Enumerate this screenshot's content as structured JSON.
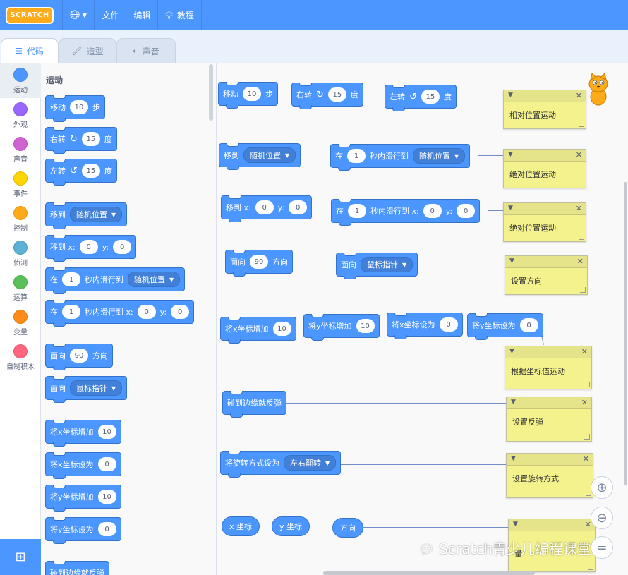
{
  "menubar": {
    "logo": "SCRATCH",
    "file": "文件",
    "edit": "编辑",
    "tutorials": "教程"
  },
  "tabs": {
    "code": "代码",
    "costumes": "造型",
    "sounds": "声音"
  },
  "categories": [
    {
      "label": "运动",
      "color": "#4c97ff"
    },
    {
      "label": "外观",
      "color": "#9966ff"
    },
    {
      "label": "声音",
      "color": "#cf63cf"
    },
    {
      "label": "事件",
      "color": "#ffd500"
    },
    {
      "label": "控制",
      "color": "#ffab19"
    },
    {
      "label": "侦测",
      "color": "#5cb1d6"
    },
    {
      "label": "运算",
      "color": "#59c059"
    },
    {
      "label": "变量",
      "color": "#ff8c1a"
    },
    {
      "label": "自制积木",
      "color": "#ff6680"
    }
  ],
  "palette": {
    "title": "运动",
    "move": {
      "a": "移动",
      "v": "10",
      "b": "步"
    },
    "turn_right": {
      "a": "右转",
      "v": "15",
      "b": "度"
    },
    "turn_left": {
      "a": "左转",
      "v": "15",
      "b": "度"
    },
    "goto": {
      "a": "移到",
      "dd": "随机位置"
    },
    "goto_xy": {
      "a": "移到 x:",
      "x": "0",
      "b": "y:",
      "y": "0"
    },
    "glide": {
      "a": "在",
      "v": "1",
      "b": "秒内滑行到",
      "dd": "随机位置"
    },
    "glide_xy": {
      "a": "在",
      "v": "1",
      "b": "秒内滑行到 x:",
      "x": "0",
      "c": "y:",
      "y": "0"
    },
    "point": {
      "a": "面向",
      "v": "90",
      "b": "方向"
    },
    "point_towards": {
      "a": "面向",
      "dd": "鼠标指针"
    },
    "change_x": {
      "a": "将x坐标增加",
      "v": "10"
    },
    "set_x": {
      "a": "将x坐标设为",
      "v": "0"
    },
    "change_y": {
      "a": "将y坐标增加",
      "v": "10"
    },
    "set_y": {
      "a": "将y坐标设为",
      "v": "0"
    },
    "bounce": "碰到边缘就反弹"
  },
  "workspace": {
    "move": {
      "a": "移动",
      "v": "10",
      "b": "步"
    },
    "turn_right": {
      "a": "右转",
      "v": "15",
      "b": "度"
    },
    "turn_left": {
      "a": "左转",
      "v": "15",
      "b": "度"
    },
    "goto": {
      "a": "移到",
      "dd": "随机位置"
    },
    "glide": {
      "a": "在",
      "v": "1",
      "b": "秒内滑行到",
      "dd": "随机位置"
    },
    "goto_xy": {
      "a": "移到 x:",
      "x": "0",
      "b": "y:",
      "y": "0"
    },
    "glide_xy": {
      "a": "在",
      "v": "1",
      "b": "秒内滑行到 x:",
      "x": "0",
      "c": "y:",
      "y": "0"
    },
    "point": {
      "a": "面向",
      "v": "90",
      "b": "方向"
    },
    "point_towards": {
      "a": "面向",
      "dd": "鼠标指针"
    },
    "change_x": {
      "a": "将x坐标增加",
      "v": "10"
    },
    "change_y": {
      "a": "将y坐标增加",
      "v": "10"
    },
    "set_x": {
      "a": "将x坐标设为",
      "v": "0"
    },
    "set_y": {
      "a": "将y坐标设为",
      "v": "0"
    },
    "bounce": "碰到边缘就反弹",
    "rotation": {
      "a": "将旋转方式设为",
      "dd": "左右翻转"
    },
    "xpos": "x 坐标",
    "ypos": "y 坐标",
    "direction": "方向",
    "notes": [
      "相对位置运动",
      "绝对位置运动",
      "绝对位置运动",
      "设置方向",
      "根据坐标值运动",
      "设置反弹",
      "设置旋转方式",
      "量"
    ]
  },
  "watermark": "Scratch青少儿编程课堂"
}
